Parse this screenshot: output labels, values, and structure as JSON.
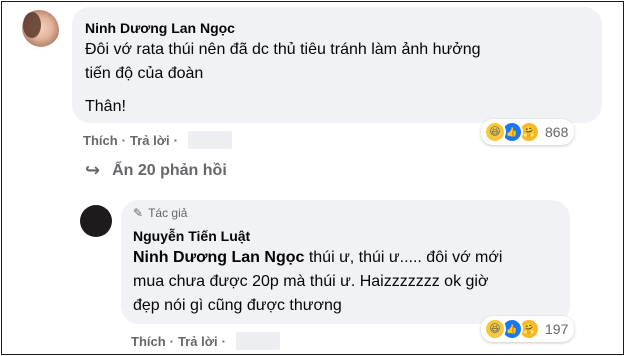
{
  "comment": {
    "author": "Ninh Dương Lan Ngọc",
    "lines": [
      "Đôi vớ rata thúi nên đã dc thủ tiêu tránh làm ảnh hưởng",
      "tiến độ của đoàn",
      "",
      "Thân!"
    ],
    "like_label": "Thích",
    "reply_label": "Trả lời",
    "reaction_count": "868",
    "reactions": [
      "haha-icon",
      "like-icon",
      "care-icon"
    ]
  },
  "hide_replies": {
    "label": "Ẩn 20 phản hồi"
  },
  "reply": {
    "author_tag": "Tác giả",
    "author": "Nguyễn Tiến Luật",
    "mention": "Ninh Dương Lan Ngọc",
    "text_first": " thúi ư, thúi ư..... đôi vớ mới",
    "lines": [
      "mua chưa được 20p mà thúi ư. Haizzzzzzz ok giờ",
      "đẹp nói gì cũng được thương"
    ],
    "like_label": "Thích",
    "reply_label": "Trả lời",
    "reaction_count": "197"
  },
  "colors": {
    "bubble": "#f0f2f5",
    "secondary_text": "#65676b",
    "like_blue": "#1877f2"
  }
}
